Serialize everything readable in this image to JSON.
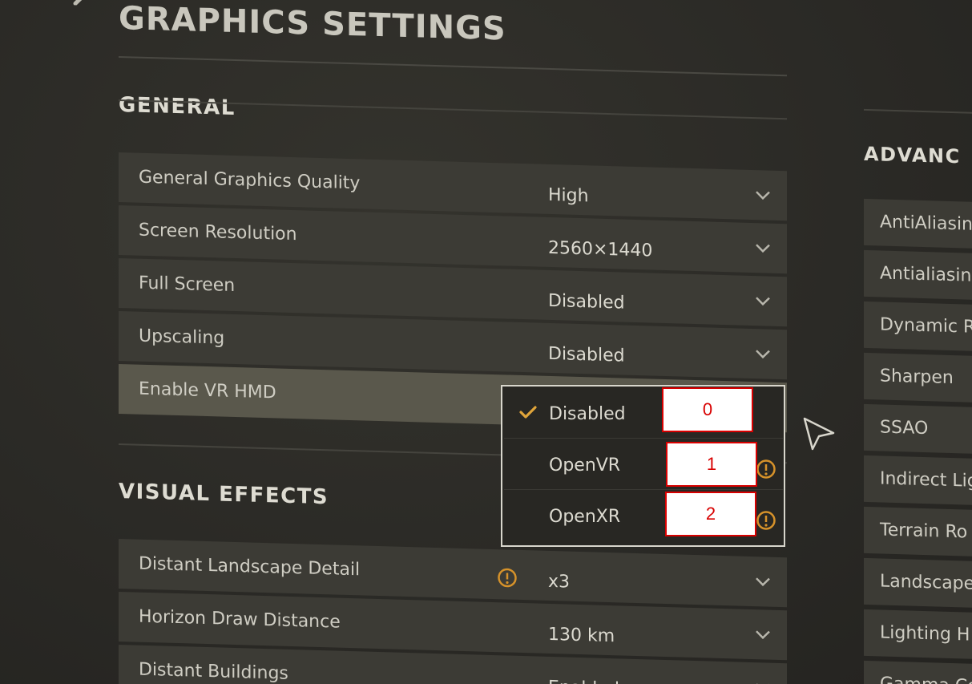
{
  "page": {
    "title": "GRAPHICS SETTINGS"
  },
  "general": {
    "heading": "GENERAL",
    "rows": [
      {
        "label": "General Graphics Quality",
        "value": "High"
      },
      {
        "label": "Screen Resolution",
        "value": "2560×1440"
      },
      {
        "label": "Full Screen",
        "value": "Disabled"
      },
      {
        "label": "Upscaling",
        "value": "Disabled"
      },
      {
        "label": "Enable VR HMD",
        "value": "Disabled"
      }
    ]
  },
  "vr_dropdown": {
    "options": [
      {
        "label": "Disabled",
        "selected": true,
        "warning": false
      },
      {
        "label": "OpenVR",
        "selected": false,
        "warning": true
      },
      {
        "label": "OpenXR",
        "selected": false,
        "warning": true
      }
    ]
  },
  "markers": [
    "0",
    "1",
    "2"
  ],
  "visual_effects": {
    "heading": "VISUAL EFFECTS",
    "rows": [
      {
        "label": "Distant Landscape Detail",
        "value": "x3",
        "warning": true
      },
      {
        "label": "Horizon Draw Distance",
        "value": "130 km",
        "warning": false
      },
      {
        "label": "Distant Buildings",
        "value": "Enabled",
        "warning": false
      }
    ]
  },
  "advanced": {
    "heading": "ADVANC",
    "rows": [
      "AntiAliasin",
      "Antialiasin",
      "Dynamic R",
      "Sharpen",
      "SSAO",
      "Indirect Lig",
      "Terrain Ro",
      "Landscape",
      "Lighting H",
      "Gamma Co"
    ]
  },
  "colors": {
    "accent_check": "#e0a53a",
    "warning_icon": "#d6922a",
    "marker_border": "#d80000",
    "row_bg": "#3c3b35",
    "row_active_bg": "#5a584c"
  },
  "icons": {
    "chevron": "chevron-down-icon",
    "warning": "warning-icon",
    "check": "check-icon",
    "back": "back-arrow-icon",
    "cursor": "mouse-cursor-icon"
  }
}
